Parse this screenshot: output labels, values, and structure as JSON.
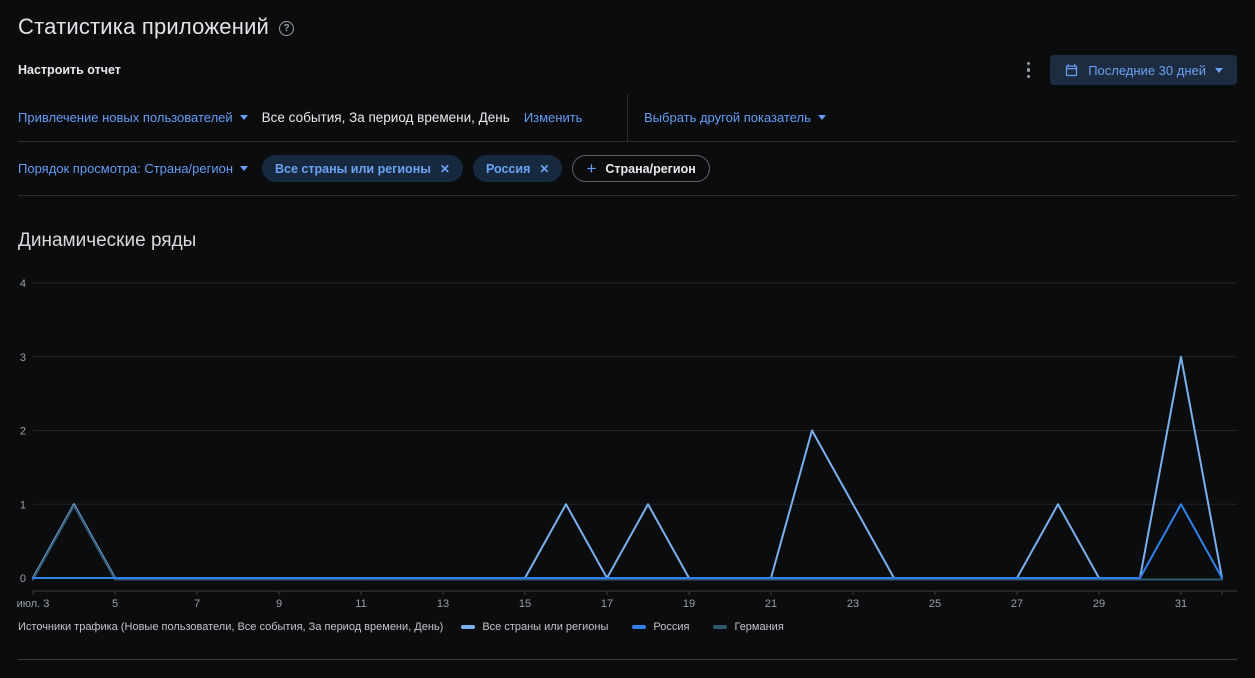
{
  "header": {
    "title": "Статистика приложений"
  },
  "report_bar": {
    "configure_label": "Настроить отчет",
    "date_range_label": "Последние 30 дней"
  },
  "metric_bar": {
    "metric_selector": "Привлечение новых пользователей",
    "metric_detail": "Все события, За период времени, День",
    "edit_link": "Изменить",
    "compare_selector": "Выбрать другой показатель"
  },
  "dimension_bar": {
    "order_selector": "Порядок просмотра: Страна/регион",
    "chips": [
      {
        "label": "Все страны или регионы"
      },
      {
        "label": "Россия"
      }
    ],
    "add_chip_label": "Страна/регион"
  },
  "section": {
    "title": "Динамические ряды"
  },
  "colors": {
    "accent_blue": "#669df6",
    "series_all_countries": "#7ab0f0",
    "series_russia": "#2e82ea",
    "series_germany": "#315973"
  },
  "chart_data": {
    "type": "line",
    "title": "Динамические ряды",
    "x": [
      3,
      4,
      5,
      6,
      7,
      8,
      9,
      10,
      11,
      12,
      13,
      14,
      15,
      16,
      17,
      18,
      19,
      20,
      21,
      22,
      23,
      24,
      25,
      26,
      27,
      28,
      29,
      30,
      31,
      32
    ],
    "x_tick_days": [
      3,
      5,
      7,
      9,
      11,
      13,
      15,
      17,
      19,
      21,
      23,
      25,
      27,
      29,
      31
    ],
    "x_tick_labels": [
      "июл. 3",
      "5",
      "7",
      "9",
      "11",
      "13",
      "15",
      "17",
      "19",
      "21",
      "23",
      "25",
      "27",
      "29",
      "31"
    ],
    "y_ticks": [
      0,
      1,
      2,
      3,
      4
    ],
    "ylim": [
      0,
      4
    ],
    "grid": true,
    "legend_position": "bottom",
    "legend_prefix": "Источники трафика (Новые пользователи, Все события, За период времени, День)",
    "series": [
      {
        "name": "Все страны или регионы",
        "color": "#7ab0f0",
        "values": [
          0,
          1,
          0,
          0,
          0,
          0,
          0,
          0,
          0,
          0,
          0,
          0,
          0,
          1,
          0,
          1,
          0,
          0,
          0,
          2,
          1,
          0,
          0,
          0,
          0,
          1,
          0,
          0,
          3,
          0
        ]
      },
      {
        "name": "Россия",
        "color": "#2e82ea",
        "values": [
          0,
          0,
          0,
          0,
          0,
          0,
          0,
          0,
          0,
          0,
          0,
          0,
          0,
          0,
          0,
          0,
          0,
          0,
          0,
          0,
          0,
          0,
          0,
          0,
          0,
          0,
          0,
          0,
          1,
          0
        ]
      },
      {
        "name": "Германия",
        "color": "#315973",
        "values": [
          0,
          1,
          0,
          0,
          0,
          0,
          0,
          0,
          0,
          0,
          0,
          0,
          0,
          0,
          0,
          0,
          0,
          0,
          0,
          0,
          0,
          0,
          0,
          0,
          0,
          0,
          0,
          0,
          0,
          0
        ]
      }
    ]
  }
}
